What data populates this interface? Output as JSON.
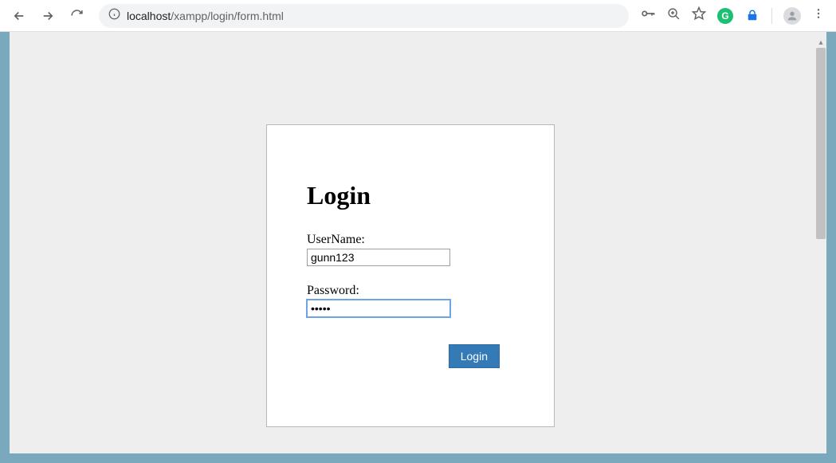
{
  "browser": {
    "url_host": "localhost",
    "url_path": "/xampp/login/form.html"
  },
  "form": {
    "title": "Login",
    "username_label": "UserName:",
    "username_value": "gunn123",
    "password_label": "Password:",
    "password_value": "•••••",
    "submit_label": "Login"
  }
}
